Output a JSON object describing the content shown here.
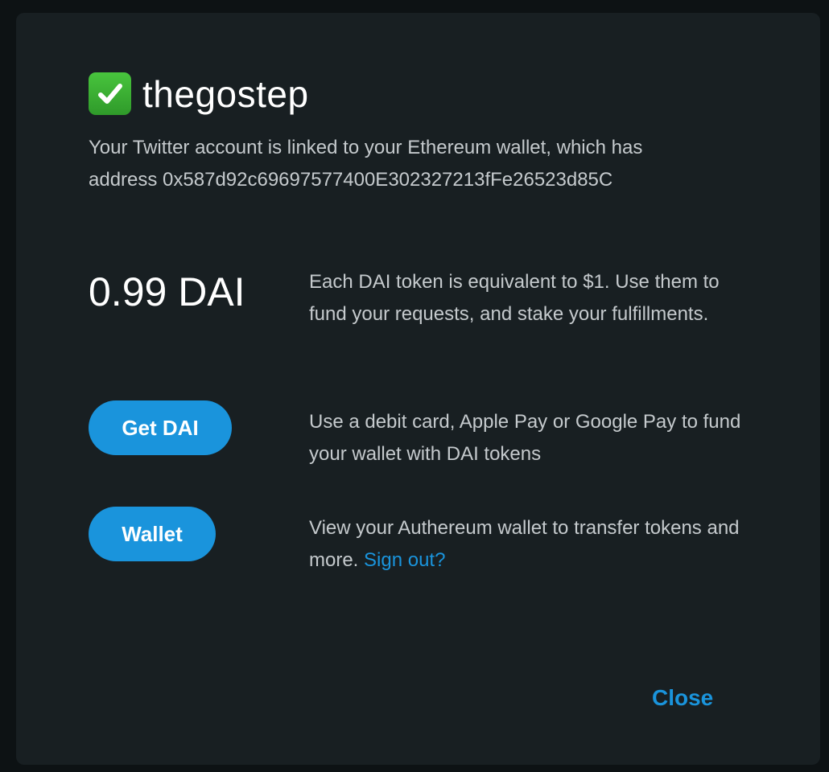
{
  "header": {
    "icon": "check-mark-icon",
    "username": "thegostep"
  },
  "link_info": {
    "line1": "Your Twitter account is linked to your Ethereum wallet, which has",
    "line2": "address 0x587d92c69697577400E302327213fFe26523d85C"
  },
  "balance": {
    "amount": "0.99 DAI",
    "description": "Each DAI token is equivalent to $1. Use them to fund your requests, and stake your fulfillments."
  },
  "get_dai": {
    "label": "Get DAI",
    "description": "Use a debit card, Apple Pay or Google Pay to fund your wallet with DAI tokens"
  },
  "wallet": {
    "label": "Wallet",
    "description": "View your Authereum wallet to transfer tokens and more. ",
    "signout_label": "Sign out?"
  },
  "footer": {
    "close_label": "Close"
  },
  "colors": {
    "accent": "#1a94dc",
    "check_green": "#3bb536",
    "background": "#181f22"
  }
}
